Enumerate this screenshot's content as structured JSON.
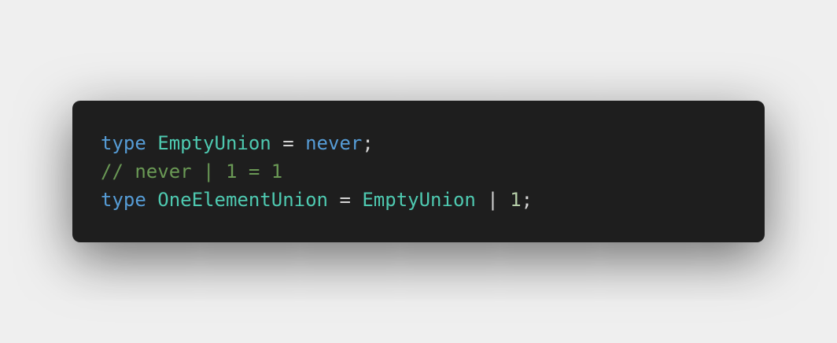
{
  "editor": {
    "language": "typescript",
    "colors": {
      "background": "#1e1e1e",
      "page_background": "#efefef",
      "keyword": "#569cd6",
      "type": "#4ec9b0",
      "plain": "#d4d4d4",
      "comment": "#6a9955",
      "number": "#b5cea8"
    },
    "lines": [
      {
        "tokens": [
          {
            "text": "type",
            "kind": "keyword"
          },
          {
            "text": " ",
            "kind": "plain"
          },
          {
            "text": "EmptyUnion",
            "kind": "type"
          },
          {
            "text": " = ",
            "kind": "plain"
          },
          {
            "text": "never",
            "kind": "keyword"
          },
          {
            "text": ";",
            "kind": "plain"
          }
        ]
      },
      {
        "tokens": [
          {
            "text": "// never | 1 = 1",
            "kind": "comment"
          }
        ]
      },
      {
        "tokens": [
          {
            "text": "type",
            "kind": "keyword"
          },
          {
            "text": " ",
            "kind": "plain"
          },
          {
            "text": "OneElementUnion",
            "kind": "type"
          },
          {
            "text": " = ",
            "kind": "plain"
          },
          {
            "text": "EmptyUnion",
            "kind": "type"
          },
          {
            "text": " | ",
            "kind": "plain"
          },
          {
            "text": "1",
            "kind": "number"
          },
          {
            "text": ";",
            "kind": "plain"
          }
        ]
      }
    ]
  }
}
